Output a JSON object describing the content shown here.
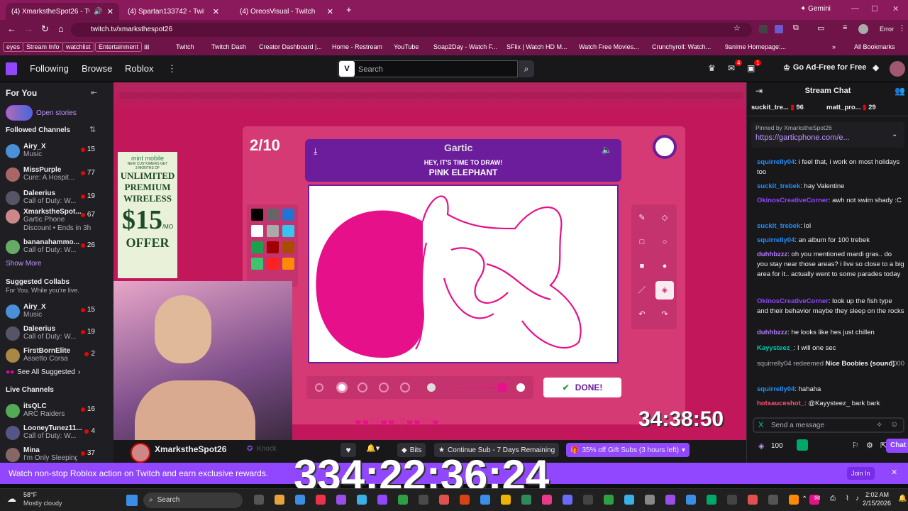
{
  "browser": {
    "tabs": [
      {
        "title": "(4) XmarkstheSpot26 - Twitch",
        "active": true
      },
      {
        "title": "(4) Spartan133742 - Twitch",
        "active": false
      },
      {
        "title": "(4) OreosVisual - Twitch",
        "active": false
      }
    ],
    "new_tab": "+",
    "gemini": "Gemini",
    "url": "twitch.tv/xmarksthespot26",
    "error_label": "Error",
    "bookmarks": [
      "eyes",
      "Stream Info",
      "watchlist",
      "Entertainment",
      "Twitch",
      "Twitch Dash",
      "Creator Dashboard |...",
      "Home - Restream",
      "YouTube",
      "Soap2Day - Watch F...",
      "SFlix | Watch HD M...",
      "Watch Free Movies...",
      "Crunchyroll: Watch...",
      "9anime Homepage:..."
    ],
    "all_bookmarks": "All Bookmarks"
  },
  "twitch_nav": {
    "following": "Following",
    "browse": "Browse",
    "roblox": "Roblox",
    "search_placeholder": "Search",
    "notif_badge_inbox": "4",
    "notif_badge_alerts": "1",
    "adfree": "Go Ad-Free for Free"
  },
  "sidebar": {
    "for_you": "For You",
    "open_stories": "Open stories",
    "followed_channels": "Followed Channels",
    "followed": [
      {
        "name": "Airy_X",
        "game": "Music",
        "viewers": "15",
        "color": "#4a90d9"
      },
      {
        "name": "MissPurple",
        "game": "Cure: A Hospit...",
        "viewers": "77",
        "color": "#a66"
      },
      {
        "name": "Daleerius",
        "game": "Call of Duty: W...",
        "viewers": "19",
        "color": "#556"
      },
      {
        "name": "XmarkstheSpot...",
        "game": "Gartic Phone",
        "extra": "Discount • Ends in 3h",
        "viewers": "67",
        "color": "#c88"
      },
      {
        "name": "bananahammo...",
        "game": "Call of Duty: W...",
        "viewers": "26",
        "color": "#6a6"
      }
    ],
    "show_more": "Show More",
    "suggested_collabs": "Suggested Collabs",
    "suggested_sub": "For You. While you're live.",
    "suggested": [
      {
        "name": "Airy_X",
        "game": "Music",
        "viewers": "15",
        "color": "#4a90d9"
      },
      {
        "name": "Daleerius",
        "game": "Call of Duty: W...",
        "viewers": "19",
        "color": "#556"
      },
      {
        "name": "FirstBornElite",
        "game": "Assetto Corsa",
        "viewers": "2",
        "color": "#a84"
      }
    ],
    "see_all": "See All Suggested",
    "live_channels": "Live Channels",
    "live": [
      {
        "name": "itsQLC",
        "game": "ARC Raiders",
        "viewers": "16",
        "color": "#5a5"
      },
      {
        "name": "LooneyTunez11...",
        "game": "Call of Duty: W...",
        "viewers": "4",
        "color": "#558"
      },
      {
        "name": "Mina",
        "game": "I'm Only Sleeping",
        "viewers": "37",
        "color": "#866"
      }
    ]
  },
  "stream": {
    "round": "2/10",
    "logo": "Gartic",
    "prompt_top": "HEY, IT'S TIME TO DRAW!",
    "prompt": "PINK ELEPHANT",
    "done": "DONE!",
    "timer": "34:38:50",
    "ad_lines": [
      "NEW CUSTOMERS GET",
      "3 MONTHS OF",
      "UNLIMITED",
      "PREMIUM",
      "WIRELESS",
      "$15",
      "/MO",
      "OFFER"
    ],
    "ad_brand": "mint mobile",
    "colors": [
      "#000000",
      "#666666",
      "#2074d4",
      "#ffffff",
      "#aaaaaa",
      "#36c5f0",
      "#18a34a",
      "#a00000",
      "#a84d00",
      "#3ec46d",
      "#ff2020",
      "#ff8a00"
    ]
  },
  "infobar": {
    "channel": "XmarkstheSpot26",
    "knock": "Knock",
    "bits": "Bits",
    "continue_sub": "Continue Sub - 7 Days Remaining",
    "gift_subs": "35% off Gift Subs (3 hours left)"
  },
  "chat": {
    "title": "Stream Chat",
    "top_chatters": [
      {
        "name": "suckit_tre...",
        "count": "96"
      },
      {
        "name": "matt_pro...",
        "count": "29"
      }
    ],
    "pinned_by": "Pinned by XmarkstheSpot26",
    "pinned_link": "https://garticphone.com/e...",
    "messages": [
      {
        "user": "squirrelly04",
        "color": "#1e90ff",
        "text": ": i feel that, i work on most holidays too"
      },
      {
        "user": "suckit_trebek",
        "color": "#1e90ff",
        "text": ": hay Valentine"
      },
      {
        "user": "OkinosCreativeCorner",
        "color": "#9147ff",
        "text": ": awh not swim shady :C"
      },
      {
        "user": "suckit_trebek",
        "color": "#1e90ff",
        "text": ": lol"
      },
      {
        "user": "squirrelly04",
        "color": "#1e90ff",
        "text": ": an album for 100 trebek"
      },
      {
        "user": "duhhbzzz",
        "color": "#b57bff",
        "text": ": oh you mentioned mardi gras.. do you stay near those areas? i live so close to a big area for it.. actually went to some parades today"
      },
      {
        "user": "OkinosCreativeCorner",
        "color": "#9147ff",
        "text": ": look up the fish type and their behavior maybe they sleep on the rocks"
      },
      {
        "user": "duhhbzzz",
        "color": "#b57bff",
        "text": ": he looks like hes just chillen"
      },
      {
        "user": "Kayysteez_",
        "color": "#00c8af",
        "text": ": I will one sec"
      }
    ],
    "redeem_user": "squirrelly04",
    "redeem_text": "redeemed",
    "redeem_item": "Nice Boobies (sound)",
    "redeem_cost": "1000",
    "after": [
      {
        "user": "squirrelly04",
        "color": "#1e90ff",
        "text": ": hahaha"
      },
      {
        "user": "hotsauceshot_",
        "color": "#ff4f7a",
        "text": ": @Kayysteez_ bark bark"
      }
    ],
    "send_placeholder": "Send a message",
    "points": "100",
    "chat_button": "Chat"
  },
  "banner": {
    "text": "Watch non-stop Roblox action on Twitch and earn exclusive rewards.",
    "overlay_timer": "334:22:36:24",
    "join": "Join In"
  },
  "taskbar": {
    "temp": "58°F",
    "weather": "Mostly cloudy",
    "search": "Search",
    "time": "2:02 AM",
    "date": "2/15/2026"
  }
}
